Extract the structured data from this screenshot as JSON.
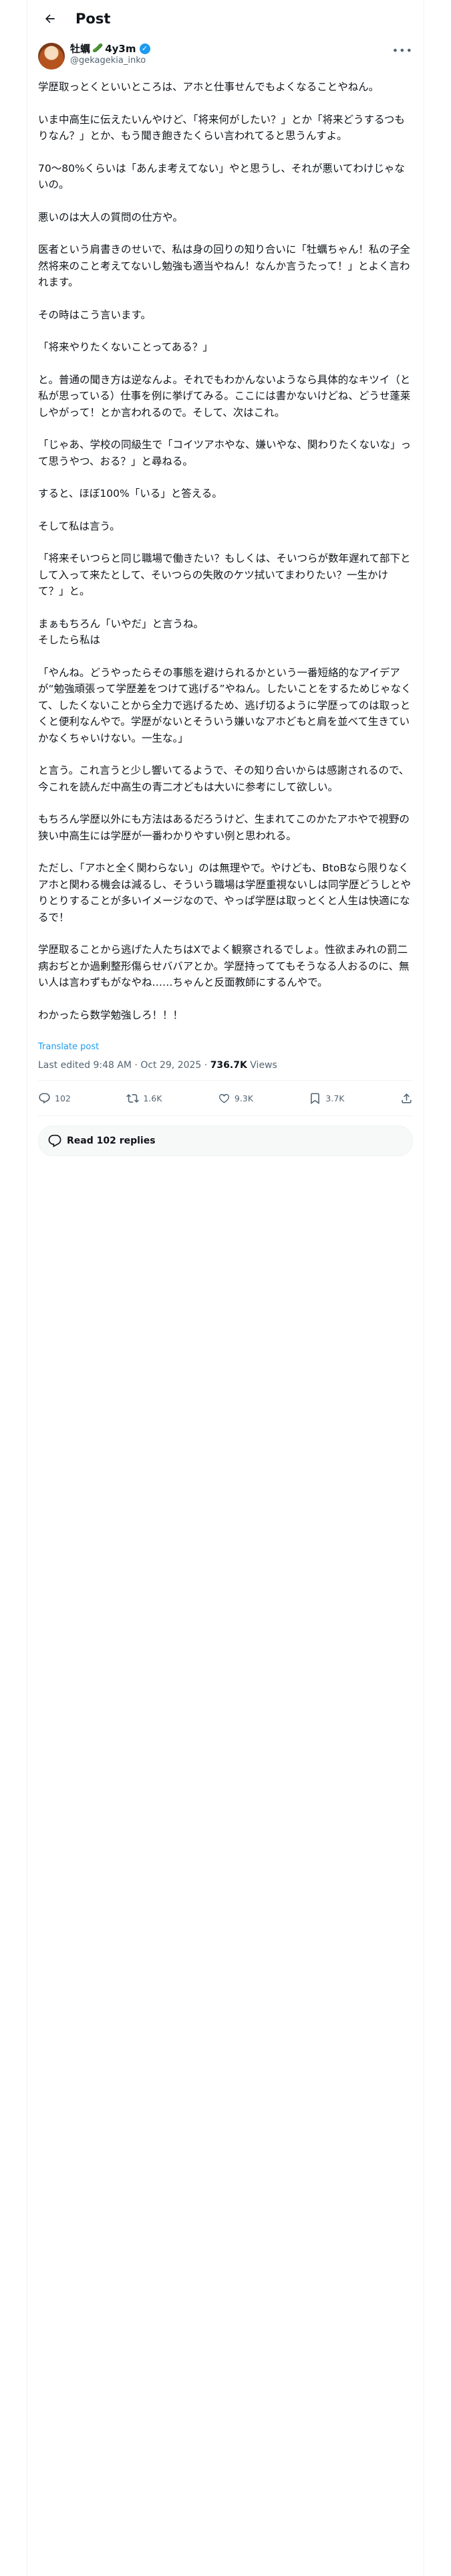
{
  "header": {
    "title": "Post"
  },
  "author": {
    "display_name": "牡蠣",
    "emoji": "🥒",
    "time_ago": "4y3m",
    "handle": "@gekagekia_inko"
  },
  "post": {
    "paragraphs": [
      "学歴取っとくといいところは、アホと仕事せんでもよくなることやねん。",
      "いま中高生に伝えたいんやけど、「将来何がしたい？」とか「将来どうするつもりなん？」とか、もう聞き飽きたくらい言われてると思うんすよ。",
      "70〜80%くらいは「あんま考えてない」やと思うし、それが悪いてわけじゃないの。",
      "悪いのは大人の質問の仕方や。",
      "医者という肩書きのせいで、私は身の回りの知り合いに「牡蠣ちゃん！私の子全然将来のこと考えてないし勉強も適当やねん！なんか言うたって！」とよく言われます。",
      "その時はこう言います。",
      "「将来やりたくないことってある？」",
      "と。普通の聞き方は逆なんよ。それでもわかんないようなら具体的なキツイ（と私が思っている）仕事を例に挙げてみる。ここには書かないけどね、どうせ蓬莱しやがって！とか言われるので。そして、次はこれ。",
      "「じゃあ、学校の同級生で「コイツアホやな、嫌いやな、関わりたくないな」って思うやつ、おる？」と尋ねる。",
      "すると、ほぼ100%「いる」と答える。",
      "そして私は言う。",
      "「将来そいつらと同じ職場で働きたい？もしくは、そいつらが数年遅れて部下として入って来たとして、そいつらの失敗のケツ拭いてまわりたい？一生かけて？」と。",
      "まぁもちろん「いやだ」と言うね。\nそしたら私は",
      "「やんね。どうやったらその事態を避けられるかという一番短絡的なアイデアが“勉強頑張って学歴差をつけて逃げる”やねん。したいことをするためじゃなくて、したくないことから全力で逃げるため、逃げ切るように学歴ってのは取っとくと便利なんやで。学歴がないとそういう嫌いなアホどもと肩を並べて生きていかなくちゃいけない。一生な。」",
      "と言う。これ言うと少し響いてるようで、その知り合いからは感謝されるので、今これを読んだ中高生の青二才どもは大いに参考にして欲しい。",
      "もちろん学歴以外にも方法はあるだろうけど、生まれてこのかたアホやで視野の狭い中高生には学歴が一番わかりやすい例と思われる。",
      "ただし、「アホと全く関わらない」のは無理やで。やけども、BtoBなら限りなくアホと関わる機会は減るし、そういう職場は学歴重視ないしは同学歴どうしとやりとりすることが多いイメージなので、やっぱ学歴は取っとくと人生は快適になるで！",
      "学歴取ることから逃げた人たちはXでよく観察されるでしょ。性欲まみれの罰二病おぢとか過剰整形傷らせババアとか。学歴持っててもそうなる人おるのに、無い人は言わずもがなやね……ちゃんと反面教師にするんやで。",
      "わかったら数学勉強しろ！！！"
    ],
    "translate_label": "Translate post",
    "last_edited": "Last edited 9:48 AM · Oct 29, 2025 · ",
    "views_count": "736.7K",
    "views_label": " Views"
  },
  "actions": {
    "replies": "102",
    "reposts": "1.6K",
    "likes": "9.3K",
    "bookmarks": "3.7K"
  },
  "read_replies": {
    "label": "Read 102 replies"
  }
}
